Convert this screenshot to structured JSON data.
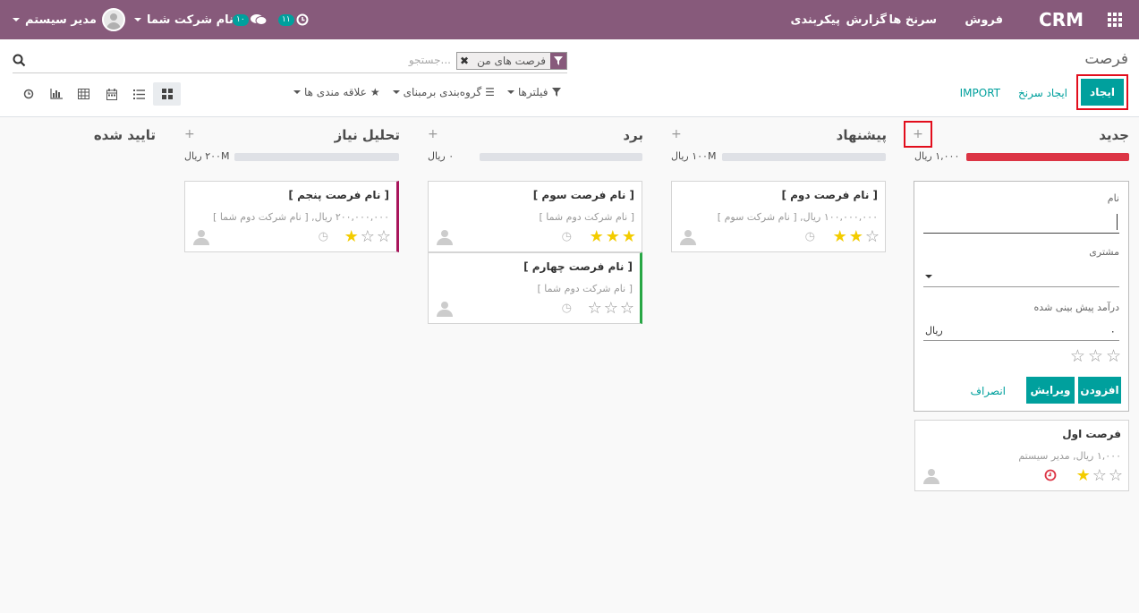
{
  "topbar": {
    "brand": "CRM",
    "menu": [
      "فروش",
      "سرنخ ها",
      "گزارش",
      "پیکربندی"
    ],
    "user": "مدیر سیستم",
    "company": "نام شرکت شما",
    "chat_count": "۱۰",
    "activity_count": "۱۱"
  },
  "control": {
    "title": "فرصت",
    "facet": "فرصت های من",
    "search_placeholder": "جستجو...",
    "create": "ایجاد",
    "quick_create": "ایجاد سرنخ",
    "import": "IMPORT",
    "filters": "فیلترها",
    "group_by": "گروه‌بندی برمبنای",
    "favorites": "علاقه مندی ها"
  },
  "columns": [
    {
      "title": "جدید",
      "total": "۱,۰۰۰ ریال"
    },
    {
      "title": "پیشنهاد",
      "total": "۱۰۰M ریال"
    },
    {
      "title": "برد",
      "total": "۰ ریال"
    },
    {
      "title": "تحلیل نیاز",
      "total": "۲۰۰M ریال"
    },
    {
      "title": "تایید شده",
      "total": ""
    }
  ],
  "quick_form": {
    "name_label": "نام",
    "customer_label": "مشتری",
    "revenue_label": "درآمد پیش بینی شده",
    "revenue_value": "۰",
    "currency": "ریال",
    "add": "افزودن",
    "edit": "ویرایش",
    "discard": "انصراف"
  },
  "cards": {
    "first": {
      "title": "فرصت اول",
      "sub": "۱,۰۰۰ ریال, مدیر سیستم",
      "stars": 1
    },
    "second": {
      "title": "[ نام فرصت دوم ]",
      "sub": "۱۰۰,۰۰۰,۰۰۰ ریال, [ نام شرکت سوم ]",
      "stars": 2
    },
    "third": {
      "title": "[ نام فرصت سوم ]",
      "sub": "[ نام شرکت دوم شما ]",
      "stars": 3
    },
    "fourth": {
      "title": "[ نام فرصت چهارم ]",
      "sub": "[ نام شرکت دوم شما ]",
      "stars": 0
    },
    "fifth": {
      "title": "[ نام فرصت پنجم ]",
      "sub": "۲۰۰,۰۰۰,۰۰۰ ریال, [ نام شرکت دوم شما ]",
      "stars": 1
    }
  },
  "colors": {
    "brand": "#875a7b",
    "accent": "#00a09d",
    "danger": "#dc3545",
    "star": "#f3cc00"
  }
}
